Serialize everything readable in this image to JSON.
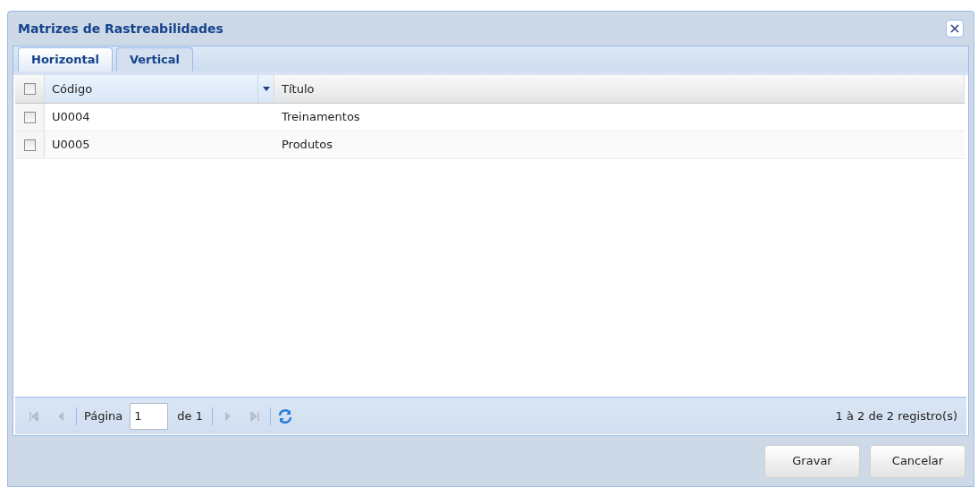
{
  "window": {
    "title": "Matrizes de Rastreabilidades"
  },
  "tabs": [
    {
      "label": "Horizontal",
      "selected": true
    },
    {
      "label": "Vertical",
      "selected": false
    }
  ],
  "table": {
    "select_all_checked": false,
    "columns": [
      {
        "label": "Código",
        "sorted": true
      },
      {
        "label": "Título",
        "sorted": false
      }
    ],
    "rows": [
      {
        "checked": false,
        "cells": [
          "U0004",
          "Treinamentos"
        ]
      },
      {
        "checked": false,
        "cells": [
          "U0005",
          "Produtos"
        ]
      }
    ]
  },
  "pager": {
    "page_label": "Página",
    "page_value": "1",
    "of_label": "de 1",
    "summary": "1 à 2 de 2 registro(s)"
  },
  "buttons": [
    "Gravar",
    "Cancelar"
  ]
}
